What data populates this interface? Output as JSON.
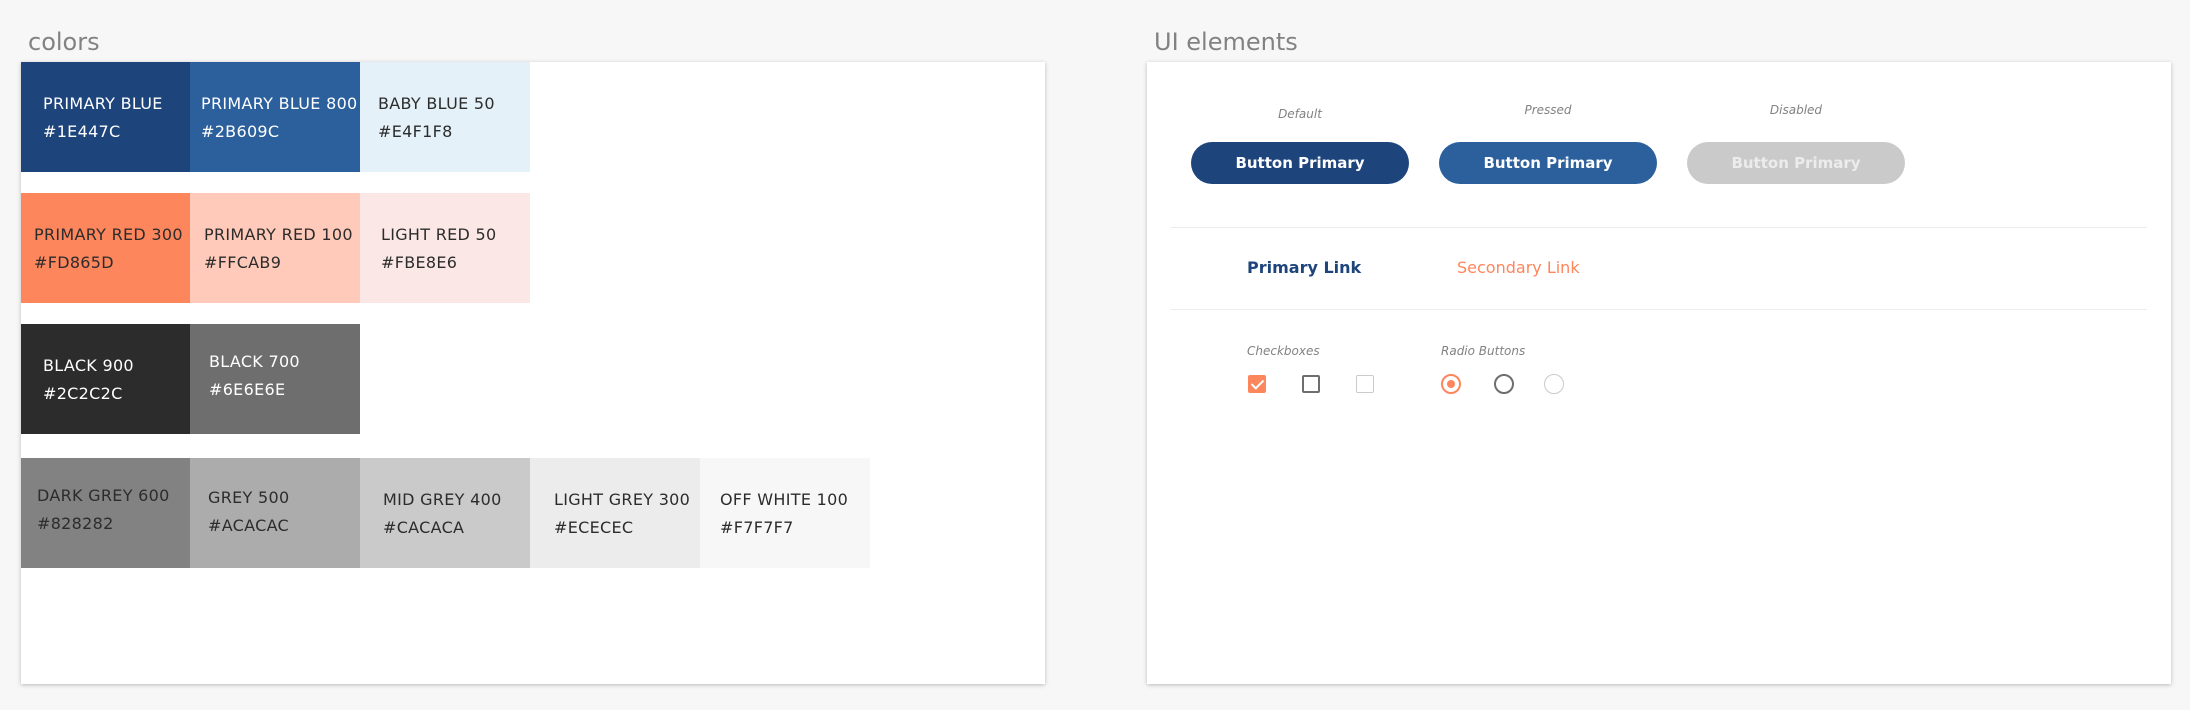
{
  "colors_section": {
    "title": "colors",
    "swatches": [
      {
        "name": "PRIMARY BLUE",
        "hex": "#1E447C",
        "color": "#1e447c"
      },
      {
        "name": "PRIMARY BLUE 800",
        "hex": "#2B609C",
        "color": "#2b609c"
      },
      {
        "name": "BABY BLUE 50",
        "hex": "#E4F1F8",
        "color": "#e4f1f8"
      },
      {
        "name": "PRIMARY RED 300",
        "hex": "#FD865D",
        "color": "#fd865d"
      },
      {
        "name": "PRIMARY RED 100",
        "hex": "#FFCAB9",
        "color": "#ffcab9"
      },
      {
        "name": "LIGHT RED 50",
        "hex": "#FBE8E6",
        "color": "#fbe8e6"
      },
      {
        "name": "BLACK 900",
        "hex": "#2C2C2C",
        "color": "#2c2c2c"
      },
      {
        "name": "BLACK 700",
        "hex": "#6E6E6E",
        "color": "#6e6e6e"
      },
      {
        "name": "DARK GREY 600",
        "hex": "#828282",
        "color": "#828282"
      },
      {
        "name": "GREY 500",
        "hex": "#ACACAC",
        "color": "#acacac"
      },
      {
        "name": "MID GREY 400",
        "hex": "#CACACA",
        "color": "#cacaca"
      },
      {
        "name": "LIGHT GREY 300",
        "hex": "#ECECEC",
        "color": "#ececec"
      },
      {
        "name": "OFF WHITE 100",
        "hex": "#F7F7F7",
        "color": "#f7f7f7"
      }
    ]
  },
  "ui_section": {
    "title": "UI elements",
    "button_states": {
      "default": "Default",
      "pressed": "Pressed",
      "disabled": "Disabled"
    },
    "buttons": {
      "default_label": "Button Primary",
      "pressed_label": "Button Primary",
      "disabled_label": "Button Primary"
    },
    "links": {
      "primary": "Primary Link",
      "secondary": "Secondary Link"
    },
    "checkboxes_label": "Checkboxes",
    "radio_buttons_label": "Radio Buttons"
  }
}
